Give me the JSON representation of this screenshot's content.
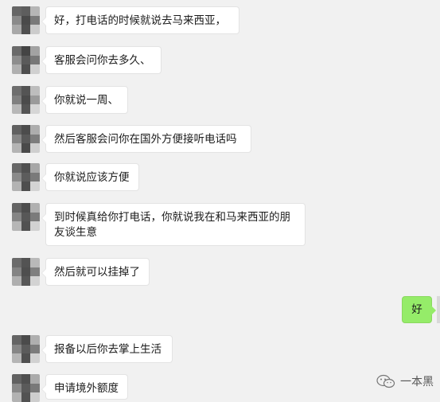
{
  "messages": [
    {
      "side": "left",
      "text": "好，打电话的时候就说去马来西亚，"
    },
    {
      "side": "left",
      "text": "客服会问你去多久、"
    },
    {
      "side": "left",
      "text": "你就说一周、"
    },
    {
      "side": "left",
      "text": "然后客服会问你在国外方便接听电话吗"
    },
    {
      "side": "left",
      "text": "你就说应该方便"
    },
    {
      "side": "left",
      "text": "到时候真给你打电话，你就说我在和马来西亚的朋\n友谈生意"
    },
    {
      "side": "left",
      "text": "然后就可以挂掉了"
    },
    {
      "side": "right",
      "text": "好"
    },
    {
      "side": "left",
      "text": "报备以后你去掌上生活"
    },
    {
      "side": "left",
      "text": "申请境外额度"
    }
  ],
  "watermark": {
    "icon": "wechat-official-account-icon",
    "text": "一本黑"
  },
  "colors": {
    "background": "#f1f1f1",
    "incoming_bubble": "#ffffff",
    "outgoing_bubble": "#95ec69"
  }
}
